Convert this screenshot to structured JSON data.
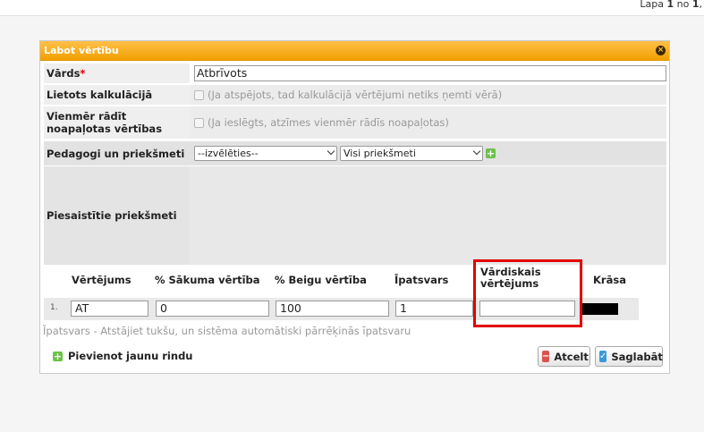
{
  "pager": {
    "prefix": "Lapa ",
    "current": "1",
    "mid": " no ",
    "total": "1",
    "suffix": ","
  },
  "dialog": {
    "title": "Labot vērtību",
    "fields": {
      "name_label": "Vārds",
      "name_required": "*",
      "name_value": "Atbrīvots",
      "used_in_calc_label": "Lietots kalkulācijā",
      "used_in_calc_hint": "(Ja atspējots, tad kalkulācijā vērtējumi netiks ņemti vērā)",
      "always_rounded_label": "Vienmēr rādīt noapaļotas vērtības",
      "always_rounded_hint": "(Ja ieslēgts, atzīmes vienmēr rādīs noapaļotas)",
      "teachers_label": "Pedagogi un priekšmeti",
      "teacher_select": "--izvēlēties--",
      "subject_select": "Visi priekšmeti",
      "attached_label": "Piesaistītie priekšmeti"
    },
    "grid": {
      "headers": [
        "Vērtējums",
        "% Sākuma vērtība",
        "% Beigu vērtība",
        "Īpatsvars",
        "Vārdiskais vērtējums",
        "Krāsa"
      ],
      "rows": [
        {
          "index": "1.",
          "grade": "AT",
          "start": "0",
          "end": "100",
          "weight": "1",
          "verbal": "",
          "color": "#000000"
        }
      ],
      "weight_hint": "Īpatsvars - Atstājiet tukšu, un sistēma automātiski pārrēķinās īpatsvaru"
    },
    "add_row_label": "Pievienot jaunu rindu",
    "cancel_label": "Atcelt",
    "save_label": "Saglabāt",
    "highlight_color": "#e00000",
    "accent_color": "#f2a000"
  }
}
